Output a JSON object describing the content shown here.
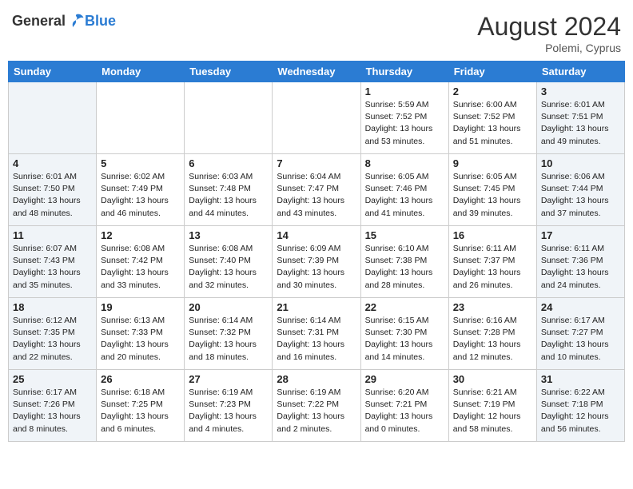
{
  "header": {
    "logo_general": "General",
    "logo_blue": "Blue",
    "month_year": "August 2024",
    "location": "Polemi, Cyprus"
  },
  "days_of_week": [
    "Sunday",
    "Monday",
    "Tuesday",
    "Wednesday",
    "Thursday",
    "Friday",
    "Saturday"
  ],
  "weeks": [
    [
      {
        "day": "",
        "info": ""
      },
      {
        "day": "",
        "info": ""
      },
      {
        "day": "",
        "info": ""
      },
      {
        "day": "",
        "info": ""
      },
      {
        "day": "1",
        "info": "Sunrise: 5:59 AM\nSunset: 7:52 PM\nDaylight: 13 hours\nand 53 minutes."
      },
      {
        "day": "2",
        "info": "Sunrise: 6:00 AM\nSunset: 7:52 PM\nDaylight: 13 hours\nand 51 minutes."
      },
      {
        "day": "3",
        "info": "Sunrise: 6:01 AM\nSunset: 7:51 PM\nDaylight: 13 hours\nand 49 minutes."
      }
    ],
    [
      {
        "day": "4",
        "info": "Sunrise: 6:01 AM\nSunset: 7:50 PM\nDaylight: 13 hours\nand 48 minutes."
      },
      {
        "day": "5",
        "info": "Sunrise: 6:02 AM\nSunset: 7:49 PM\nDaylight: 13 hours\nand 46 minutes."
      },
      {
        "day": "6",
        "info": "Sunrise: 6:03 AM\nSunset: 7:48 PM\nDaylight: 13 hours\nand 44 minutes."
      },
      {
        "day": "7",
        "info": "Sunrise: 6:04 AM\nSunset: 7:47 PM\nDaylight: 13 hours\nand 43 minutes."
      },
      {
        "day": "8",
        "info": "Sunrise: 6:05 AM\nSunset: 7:46 PM\nDaylight: 13 hours\nand 41 minutes."
      },
      {
        "day": "9",
        "info": "Sunrise: 6:05 AM\nSunset: 7:45 PM\nDaylight: 13 hours\nand 39 minutes."
      },
      {
        "day": "10",
        "info": "Sunrise: 6:06 AM\nSunset: 7:44 PM\nDaylight: 13 hours\nand 37 minutes."
      }
    ],
    [
      {
        "day": "11",
        "info": "Sunrise: 6:07 AM\nSunset: 7:43 PM\nDaylight: 13 hours\nand 35 minutes."
      },
      {
        "day": "12",
        "info": "Sunrise: 6:08 AM\nSunset: 7:42 PM\nDaylight: 13 hours\nand 33 minutes."
      },
      {
        "day": "13",
        "info": "Sunrise: 6:08 AM\nSunset: 7:40 PM\nDaylight: 13 hours\nand 32 minutes."
      },
      {
        "day": "14",
        "info": "Sunrise: 6:09 AM\nSunset: 7:39 PM\nDaylight: 13 hours\nand 30 minutes."
      },
      {
        "day": "15",
        "info": "Sunrise: 6:10 AM\nSunset: 7:38 PM\nDaylight: 13 hours\nand 28 minutes."
      },
      {
        "day": "16",
        "info": "Sunrise: 6:11 AM\nSunset: 7:37 PM\nDaylight: 13 hours\nand 26 minutes."
      },
      {
        "day": "17",
        "info": "Sunrise: 6:11 AM\nSunset: 7:36 PM\nDaylight: 13 hours\nand 24 minutes."
      }
    ],
    [
      {
        "day": "18",
        "info": "Sunrise: 6:12 AM\nSunset: 7:35 PM\nDaylight: 13 hours\nand 22 minutes."
      },
      {
        "day": "19",
        "info": "Sunrise: 6:13 AM\nSunset: 7:33 PM\nDaylight: 13 hours\nand 20 minutes."
      },
      {
        "day": "20",
        "info": "Sunrise: 6:14 AM\nSunset: 7:32 PM\nDaylight: 13 hours\nand 18 minutes."
      },
      {
        "day": "21",
        "info": "Sunrise: 6:14 AM\nSunset: 7:31 PM\nDaylight: 13 hours\nand 16 minutes."
      },
      {
        "day": "22",
        "info": "Sunrise: 6:15 AM\nSunset: 7:30 PM\nDaylight: 13 hours\nand 14 minutes."
      },
      {
        "day": "23",
        "info": "Sunrise: 6:16 AM\nSunset: 7:28 PM\nDaylight: 13 hours\nand 12 minutes."
      },
      {
        "day": "24",
        "info": "Sunrise: 6:17 AM\nSunset: 7:27 PM\nDaylight: 13 hours\nand 10 minutes."
      }
    ],
    [
      {
        "day": "25",
        "info": "Sunrise: 6:17 AM\nSunset: 7:26 PM\nDaylight: 13 hours\nand 8 minutes."
      },
      {
        "day": "26",
        "info": "Sunrise: 6:18 AM\nSunset: 7:25 PM\nDaylight: 13 hours\nand 6 minutes."
      },
      {
        "day": "27",
        "info": "Sunrise: 6:19 AM\nSunset: 7:23 PM\nDaylight: 13 hours\nand 4 minutes."
      },
      {
        "day": "28",
        "info": "Sunrise: 6:19 AM\nSunset: 7:22 PM\nDaylight: 13 hours\nand 2 minutes."
      },
      {
        "day": "29",
        "info": "Sunrise: 6:20 AM\nSunset: 7:21 PM\nDaylight: 13 hours\nand 0 minutes."
      },
      {
        "day": "30",
        "info": "Sunrise: 6:21 AM\nSunset: 7:19 PM\nDaylight: 12 hours\nand 58 minutes."
      },
      {
        "day": "31",
        "info": "Sunrise: 6:22 AM\nSunset: 7:18 PM\nDaylight: 12 hours\nand 56 minutes."
      }
    ]
  ]
}
